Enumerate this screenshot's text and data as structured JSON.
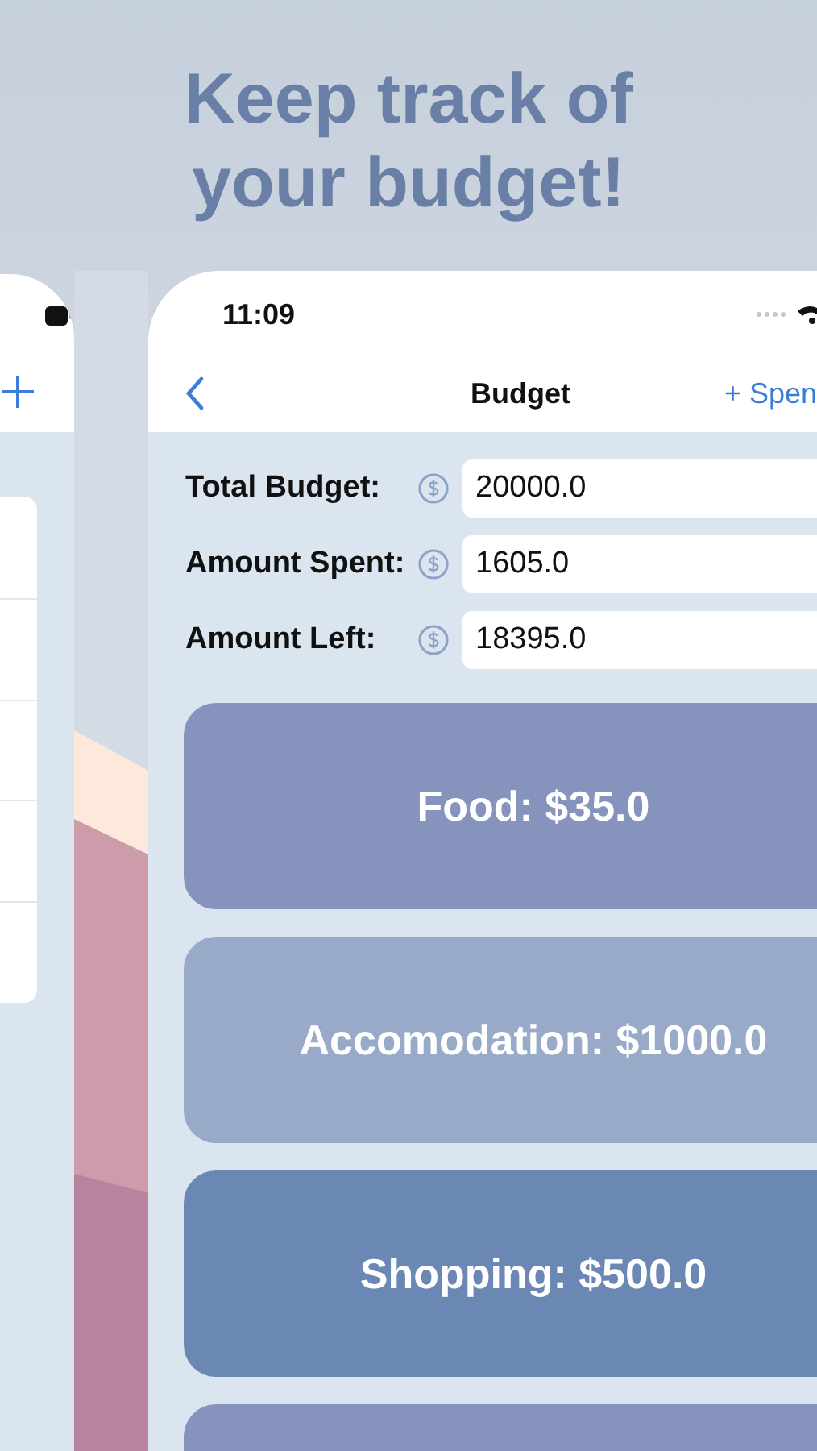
{
  "headline": "Keep track of your budget!",
  "status_bar": {
    "time": "11:09"
  },
  "nav": {
    "title": "Budget",
    "action": "+ Spen"
  },
  "fields": [
    {
      "label": "Total Budget:",
      "value": "20000.0"
    },
    {
      "label": "Amount Spent:",
      "value": "1605.0"
    },
    {
      "label": "Amount Left:",
      "value": "18395.0"
    }
  ],
  "categories": [
    {
      "label": "Food: $35.0",
      "color": "#8694bd"
    },
    {
      "label": "Accomodation: $1000.0",
      "color": "#98aac8"
    },
    {
      "label": "Shopping: $500.0",
      "color": "#6b88b4"
    },
    {
      "color": "#8694bd"
    }
  ]
}
